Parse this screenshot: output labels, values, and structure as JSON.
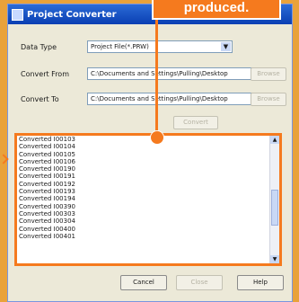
{
  "callout": {
    "text": "produced."
  },
  "window": {
    "title": "Project Converter"
  },
  "form": {
    "data_type_label": "Data Type",
    "data_type_value": "Project File(*.PRW)",
    "convert_from_label": "Convert From",
    "convert_from_value": "C:\\Documents and Settings\\Pulling\\Desktop",
    "convert_to_label": "Convert To",
    "convert_to_value": "C:\\Documents and Settings\\Pulling\\Desktop",
    "browse_label": "Browse",
    "browse2_label": "Browse",
    "convert_label": "Convert"
  },
  "log": {
    "lines": [
      "Converted I00103",
      "Converted I00104",
      "Converted I00105",
      "Converted I00106",
      "Converted I00190",
      "Converted I00191",
      "Converted I00192",
      "Converted I00193",
      "Converted I00194",
      "Converted I00390",
      "Converted I00303",
      "Converted I00304",
      "Converted I00400",
      "Converted I00401"
    ]
  },
  "buttons": {
    "cancel": "Cancel",
    "close": "Close",
    "help": "Help"
  },
  "colors": {
    "accent": "#f57a1e",
    "titlebar": "#0a3fb3"
  }
}
